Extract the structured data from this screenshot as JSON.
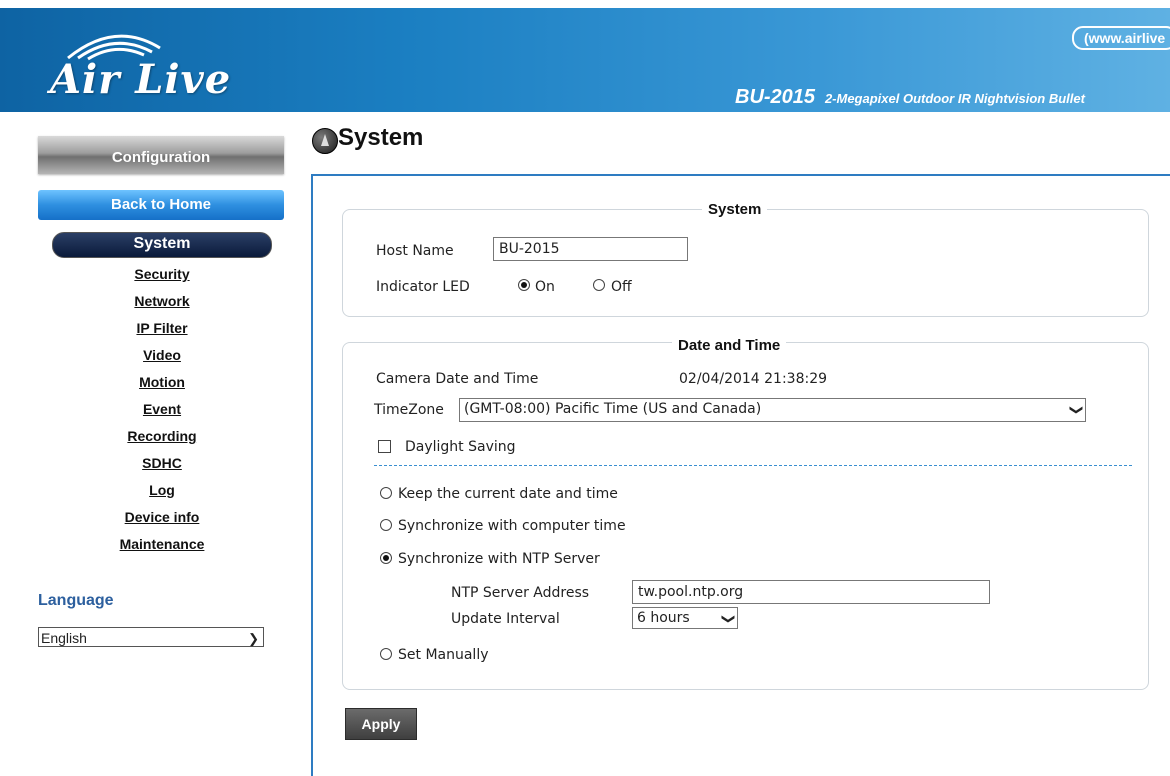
{
  "header": {
    "logo_text": "Air Live",
    "url": "(www.airlive",
    "model_name": "BU-2015",
    "model_desc": "2-Megapixel Outdoor IR Nightvision Bullet",
    "bg_color": "#1b7fc2"
  },
  "sidebar": {
    "config_label": "Configuration",
    "back_label": "Back to Home",
    "items": [
      {
        "label": "System",
        "active": true
      },
      {
        "label": "Security"
      },
      {
        "label": "Network"
      },
      {
        "label": "IP Filter"
      },
      {
        "label": "Video"
      },
      {
        "label": "Motion"
      },
      {
        "label": "Event"
      },
      {
        "label": "Recording"
      },
      {
        "label": "SDHC"
      },
      {
        "label": "Log"
      },
      {
        "label": "Device info"
      },
      {
        "label": "Maintenance"
      }
    ],
    "language_label": "Language",
    "language_value": "English"
  },
  "page": {
    "title": "System"
  },
  "system_group": {
    "legend": "System",
    "host_name_label": "Host Name",
    "host_name_value": "BU-2015",
    "led_label": "Indicator LED",
    "led_on": "On",
    "led_off": "Off",
    "led_selected": "On"
  },
  "datetime_group": {
    "legend": "Date and Time",
    "camera_dt_label": "Camera Date and Time",
    "camera_dt_value": "02/04/2014 21:38:29",
    "timezone_label": "TimeZone",
    "timezone_value": "(GMT-08:00) Pacific Time (US and Canada)",
    "daylight_label": "Daylight Saving",
    "daylight_checked": false,
    "options": [
      "Keep the current date and time",
      "Synchronize with computer time",
      "Synchronize with NTP Server",
      "Set Manually"
    ],
    "selected_option": "Synchronize with NTP Server",
    "ntp_label": "NTP Server Address",
    "ntp_value": "tw.pool.ntp.org",
    "interval_label": "Update Interval",
    "interval_value": "6 hours"
  },
  "apply_label": "Apply",
  "icons": {
    "chevron": "chevron-down-icon",
    "title": "system-icon"
  },
  "colors": {
    "accent_blue": "#2e7cc2",
    "nav_active": "#0a1a3a",
    "language_label": "#2c5f9e"
  }
}
